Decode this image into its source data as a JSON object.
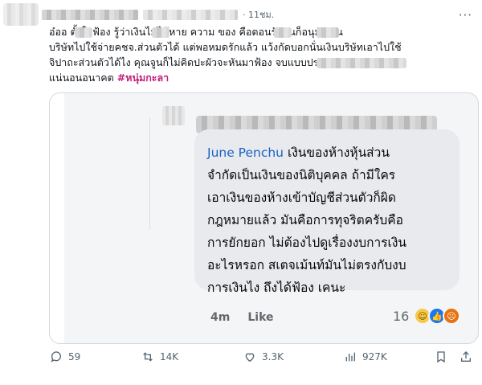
{
  "post": {
    "time": "· 11ชม.",
    "lines": [
      "อ๋ออ        ตั้งใจฟ้อง       รู้ว่าเงินไม่ได้หาย ความ    ของ        คือตอนรักกันก็อนุมัติเงิน",
      "บริษัทไปใช้จ่ายคชจ.ส่วนตัวได้ แต่พอหมดรักแล้ว แว้งกัดบอกนั่นเงินบริษัทเอาไปใช้",
      "จิปาถะส่วนตัวได้ไง คุณจูนก็ไม่คิดปะผัวจะหันมาฟ้อง                      จบแบบปรเมศ"
    ],
    "last_line_text": "แน่นอนอนาคต ",
    "hashtag": "#หนุ่มกะลา"
  },
  "media": {
    "author": "June Penchu",
    "comment_lines": [
      " เงินของห้างหุ้นส่วน",
      "จำกัดเป็นเงินของนิติบุคคล ถ้ามีใคร",
      "เอาเงินของห้างเข้าบัญชีส่วนตัวก็ผิด",
      "กฎหมายแล้ว มันคือการทุจริตครับคือ",
      "การยักยอก ไม่ต้องไปดูเรื่องงบการเงิน",
      "อะไรหรอก สเตจเม้นท์มันไม่ตรงกับงบ",
      "การเงินไง ถึงได้ฟ้อง เคนะ"
    ],
    "time": "4m",
    "like_label": "Like",
    "reaction_count": "16"
  },
  "actions": {
    "replies": "59",
    "reposts": "14K",
    "likes": "3.3K",
    "views": "927K"
  },
  "colors": {
    "link": "#1d9bf0",
    "author": "#1b62c4",
    "muted": "#536471"
  }
}
